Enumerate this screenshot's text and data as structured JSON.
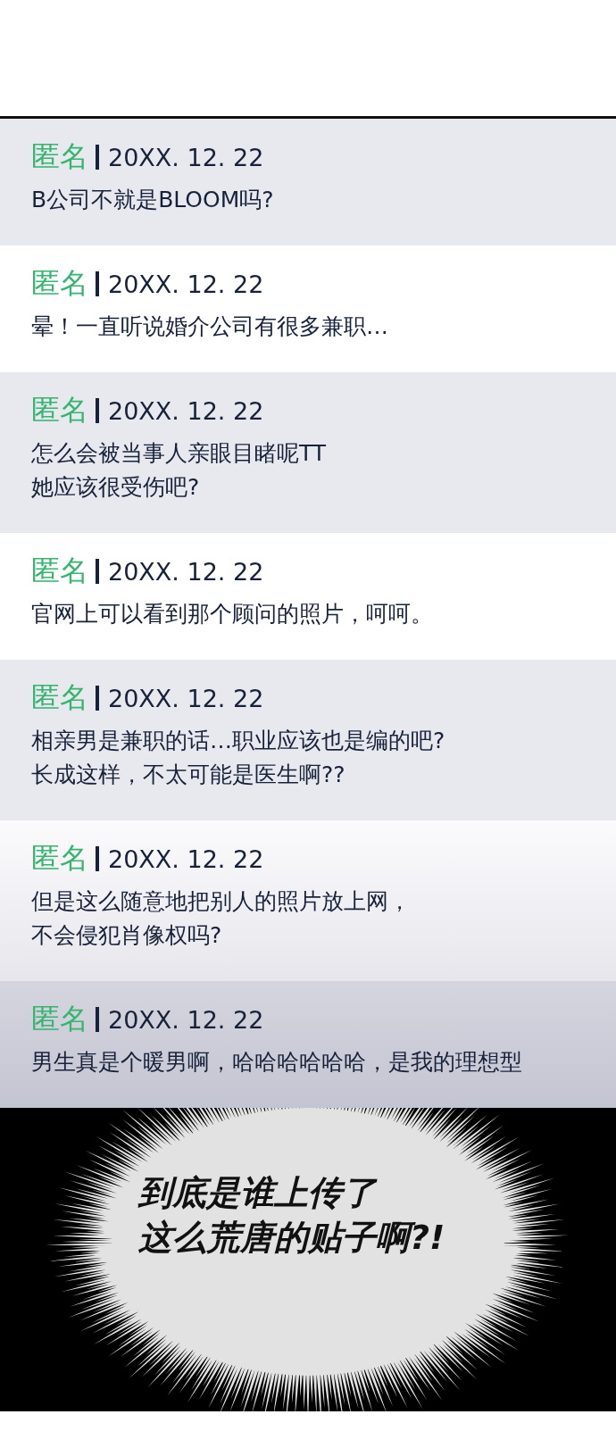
{
  "comments": [
    {
      "author": "匿名",
      "date": "20XX. 12. 22",
      "lines": [
        "B公司不就是BLOOM吗?"
      ]
    },
    {
      "author": "匿名",
      "date": "20XX. 12. 22",
      "lines": [
        "晕！一直听说婚介公司有很多兼职…"
      ]
    },
    {
      "author": "匿名",
      "date": "20XX. 12. 22",
      "lines": [
        "怎么会被当事人亲眼目睹呢TT",
        "她应该很受伤吧?"
      ]
    },
    {
      "author": "匿名",
      "date": "20XX. 12. 22",
      "lines": [
        "官网上可以看到那个顾问的照片，呵呵。"
      ]
    },
    {
      "author": "匿名",
      "date": "20XX. 12. 22",
      "lines": [
        "相亲男是兼职的话…职业应该也是编的吧?",
        "长成这样，不太可能是医生啊??"
      ]
    },
    {
      "author": "匿名",
      "date": "20XX. 12. 22",
      "lines": [
        "但是这么随意地把别人的照片放上网，",
        "不会侵犯肖像权吗?"
      ]
    },
    {
      "author": "匿名",
      "date": "20XX. 12. 22",
      "lines": [
        "男生真是个暖男啊，哈哈哈哈哈哈，是我的理想型"
      ]
    }
  ],
  "exclamation": [
    "到底是谁上传了",
    "这么荒唐的贴子啊?!"
  ]
}
